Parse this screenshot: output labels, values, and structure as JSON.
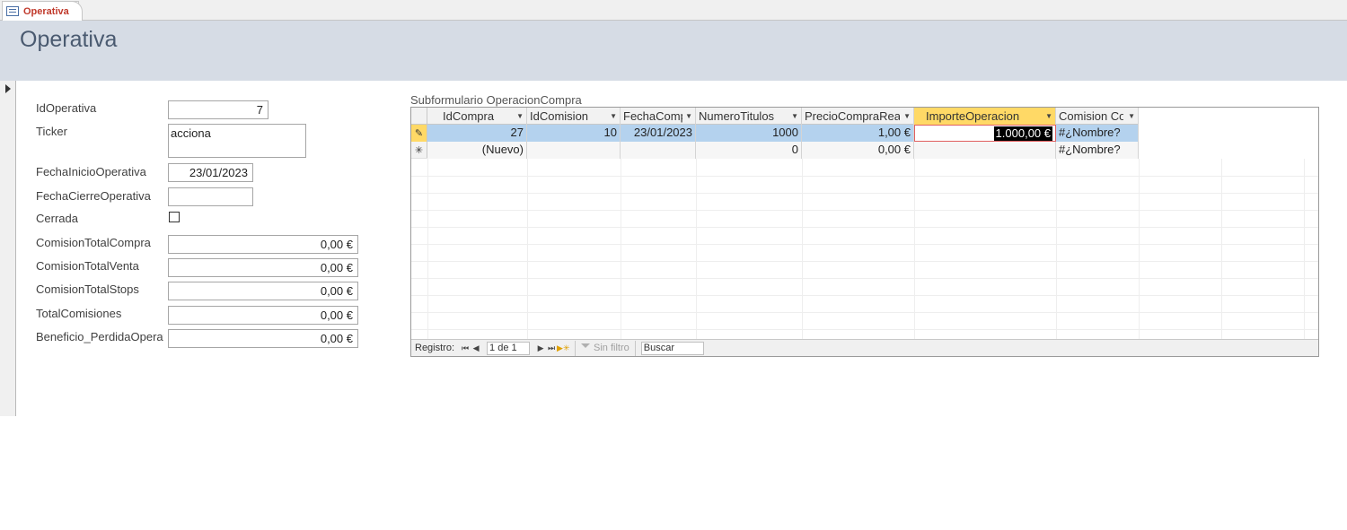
{
  "tab": {
    "label": "Operativa"
  },
  "header": {
    "title": "Operativa"
  },
  "form": {
    "fields": [
      {
        "label": "IdOperativa",
        "value": "7"
      },
      {
        "label": "Ticker",
        "value": "acciona"
      },
      {
        "label": "FechaInicioOperativa",
        "value": "23/01/2023"
      },
      {
        "label": "FechaCierreOperativa",
        "value": ""
      },
      {
        "label": "Cerrada",
        "value": ""
      },
      {
        "label": "ComisionTotalCompra",
        "value": "0,00 €"
      },
      {
        "label": "ComisionTotalVenta",
        "value": "0,00 €"
      },
      {
        "label": "ComisionTotalStops",
        "value": "0,00 €"
      },
      {
        "label": "TotalComisiones",
        "value": "0,00 €"
      },
      {
        "label": "Beneficio_PerdidaOperativa",
        "value": "0,00 €"
      }
    ]
  },
  "subform": {
    "label": "Subformulario OperacionCompra",
    "columns": [
      "IdCompra",
      "IdComision",
      "FechaCompra",
      "NumeroTitulos",
      "PrecioCompraReal",
      "ImporteOperacion",
      "Comision Compra"
    ],
    "rows": [
      [
        "27",
        "10",
        "23/01/2023",
        "1000",
        "1,00 €",
        "1.000,00 €",
        "#¿Nombre?"
      ],
      [
        "(Nuevo)",
        "",
        "",
        "0",
        "0,00 €",
        "",
        "#¿Nombre?"
      ]
    ],
    "nav": {
      "label": "Registro:",
      "position": "1 de 1",
      "filter": "Sin filtro",
      "search": "Buscar"
    }
  }
}
